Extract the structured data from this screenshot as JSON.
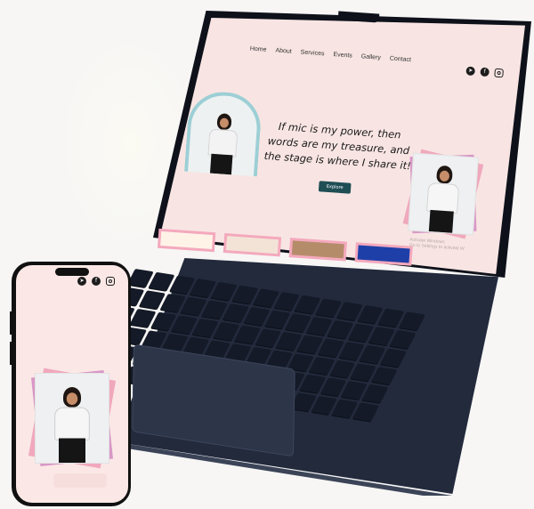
{
  "laptop": {
    "nav": [
      "Home",
      "About",
      "Services",
      "Events",
      "Gallery",
      "Contact"
    ],
    "quote": "If mic is my power, then words are my treasure, and the stage is where I share it!",
    "explore_button": "Explore",
    "activate_title": "Activate Windows",
    "activate_sub": "Go to Settings to activate W",
    "social_icons": [
      "telegram-icon",
      "facebook-icon",
      "instagram-icon"
    ]
  },
  "phone": {
    "social_icons": [
      "telegram-icon",
      "facebook-icon",
      "instagram-icon"
    ]
  },
  "colors": {
    "screen_bg": "#f8e5e3",
    "accent_button": "#1f4e55",
    "frame_pink": "#f0a8bd",
    "arch_teal": "#9ccfd5",
    "laptop_body": "#222a3c"
  }
}
